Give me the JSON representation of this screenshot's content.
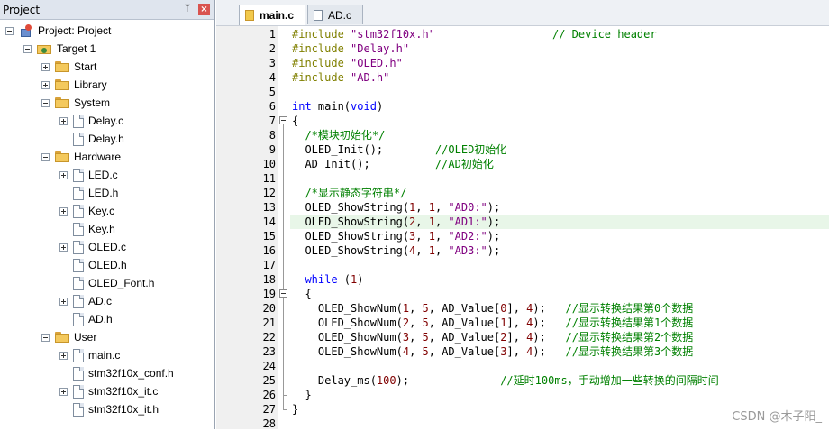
{
  "project_panel": {
    "title": "Project",
    "pin_glyph": "ᛘ",
    "close_glyph": "×",
    "tree": [
      {
        "label": "Project: Project",
        "kind": "project",
        "expander": "minus",
        "level": 0
      },
      {
        "label": "Target 1",
        "kind": "target",
        "expander": "minus",
        "level": 1
      },
      {
        "label": "Start",
        "kind": "folder",
        "expander": "plus",
        "level": 2
      },
      {
        "label": "Library",
        "kind": "folder",
        "expander": "plus",
        "level": 2
      },
      {
        "label": "System",
        "kind": "folder",
        "expander": "minus",
        "level": 2
      },
      {
        "label": "Delay.c",
        "kind": "file",
        "expander": "plus",
        "level": 3
      },
      {
        "label": "Delay.h",
        "kind": "file",
        "expander": "none",
        "level": 3
      },
      {
        "label": "Hardware",
        "kind": "folder",
        "expander": "minus",
        "level": 2
      },
      {
        "label": "LED.c",
        "kind": "file",
        "expander": "plus",
        "level": 3
      },
      {
        "label": "LED.h",
        "kind": "file",
        "expander": "none",
        "level": 3
      },
      {
        "label": "Key.c",
        "kind": "file",
        "expander": "plus",
        "level": 3
      },
      {
        "label": "Key.h",
        "kind": "file",
        "expander": "none",
        "level": 3
      },
      {
        "label": "OLED.c",
        "kind": "file",
        "expander": "plus",
        "level": 3
      },
      {
        "label": "OLED.h",
        "kind": "file",
        "expander": "none",
        "level": 3
      },
      {
        "label": "OLED_Font.h",
        "kind": "file",
        "expander": "none",
        "level": 3
      },
      {
        "label": "AD.c",
        "kind": "file",
        "expander": "plus",
        "level": 3
      },
      {
        "label": "AD.h",
        "kind": "file",
        "expander": "none",
        "level": 3
      },
      {
        "label": "User",
        "kind": "folder",
        "expander": "minus",
        "level": 2
      },
      {
        "label": "main.c",
        "kind": "file",
        "expander": "plus",
        "level": 3
      },
      {
        "label": "stm32f10x_conf.h",
        "kind": "file",
        "expander": "none",
        "level": 3
      },
      {
        "label": "stm32f10x_it.c",
        "kind": "file",
        "expander": "plus",
        "level": 3
      },
      {
        "label": "stm32f10x_it.h",
        "kind": "file",
        "expander": "none",
        "level": 3
      }
    ]
  },
  "tabs": [
    {
      "label": "main.c",
      "active": true
    },
    {
      "label": "AD.c",
      "active": false
    }
  ],
  "editor": {
    "highlighted_line": 14,
    "lines": [
      [
        [
          "pp",
          "#include "
        ],
        [
          "str",
          "\"stm32f10x.h\""
        ],
        [
          "t",
          "                  "
        ],
        [
          "cm",
          "// Device header"
        ]
      ],
      [
        [
          "pp",
          "#include "
        ],
        [
          "str",
          "\"Delay.h\""
        ]
      ],
      [
        [
          "pp",
          "#include "
        ],
        [
          "str",
          "\"OLED.h\""
        ]
      ],
      [
        [
          "pp",
          "#include "
        ],
        [
          "str",
          "\"AD.h\""
        ]
      ],
      [],
      [
        [
          "kw",
          "int"
        ],
        [
          "t",
          " main("
        ],
        [
          "kw",
          "void"
        ],
        [
          "t",
          ")"
        ]
      ],
      [
        [
          "t",
          "{"
        ]
      ],
      [
        [
          "t",
          "  "
        ],
        [
          "cm",
          "/*模块初始化*/"
        ]
      ],
      [
        [
          "t",
          "  OLED_Init();        "
        ],
        [
          "cm",
          "//OLED初始化"
        ]
      ],
      [
        [
          "t",
          "  AD_Init();          "
        ],
        [
          "cm",
          "//AD初始化"
        ]
      ],
      [],
      [
        [
          "t",
          "  "
        ],
        [
          "cm",
          "/*显示静态字符串*/"
        ]
      ],
      [
        [
          "t",
          "  OLED_ShowString("
        ],
        [
          "num",
          "1"
        ],
        [
          "t",
          ", "
        ],
        [
          "num",
          "1"
        ],
        [
          "t",
          ", "
        ],
        [
          "str",
          "\"AD0:\""
        ],
        [
          "t",
          ");"
        ]
      ],
      [
        [
          "t",
          "  OLED_ShowString("
        ],
        [
          "num",
          "2"
        ],
        [
          "t",
          ", "
        ],
        [
          "num",
          "1"
        ],
        [
          "t",
          ", "
        ],
        [
          "str",
          "\"AD1:\""
        ],
        [
          "t",
          ");"
        ]
      ],
      [
        [
          "t",
          "  OLED_ShowString("
        ],
        [
          "num",
          "3"
        ],
        [
          "t",
          ", "
        ],
        [
          "num",
          "1"
        ],
        [
          "t",
          ", "
        ],
        [
          "str",
          "\"AD2:\""
        ],
        [
          "t",
          ");"
        ]
      ],
      [
        [
          "t",
          "  OLED_ShowString("
        ],
        [
          "num",
          "4"
        ],
        [
          "t",
          ", "
        ],
        [
          "num",
          "1"
        ],
        [
          "t",
          ", "
        ],
        [
          "str",
          "\"AD3:\""
        ],
        [
          "t",
          ");"
        ]
      ],
      [],
      [
        [
          "t",
          "  "
        ],
        [
          "kw",
          "while"
        ],
        [
          "t",
          " ("
        ],
        [
          "num",
          "1"
        ],
        [
          "t",
          ")"
        ]
      ],
      [
        [
          "t",
          "  {"
        ]
      ],
      [
        [
          "t",
          "    OLED_ShowNum("
        ],
        [
          "num",
          "1"
        ],
        [
          "t",
          ", "
        ],
        [
          "num",
          "5"
        ],
        [
          "t",
          ", AD_Value["
        ],
        [
          "num",
          "0"
        ],
        [
          "t",
          "], "
        ],
        [
          "num",
          "4"
        ],
        [
          "t",
          ");   "
        ],
        [
          "cm",
          "//显示转换结果第0个数据"
        ]
      ],
      [
        [
          "t",
          "    OLED_ShowNum("
        ],
        [
          "num",
          "2"
        ],
        [
          "t",
          ", "
        ],
        [
          "num",
          "5"
        ],
        [
          "t",
          ", AD_Value["
        ],
        [
          "num",
          "1"
        ],
        [
          "t",
          "], "
        ],
        [
          "num",
          "4"
        ],
        [
          "t",
          ");   "
        ],
        [
          "cm",
          "//显示转换结果第1个数据"
        ]
      ],
      [
        [
          "t",
          "    OLED_ShowNum("
        ],
        [
          "num",
          "3"
        ],
        [
          "t",
          ", "
        ],
        [
          "num",
          "5"
        ],
        [
          "t",
          ", AD_Value["
        ],
        [
          "num",
          "2"
        ],
        [
          "t",
          "], "
        ],
        [
          "num",
          "4"
        ],
        [
          "t",
          ");   "
        ],
        [
          "cm",
          "//显示转换结果第2个数据"
        ]
      ],
      [
        [
          "t",
          "    OLED_ShowNum("
        ],
        [
          "num",
          "4"
        ],
        [
          "t",
          ", "
        ],
        [
          "num",
          "5"
        ],
        [
          "t",
          ", AD_Value["
        ],
        [
          "num",
          "3"
        ],
        [
          "t",
          "], "
        ],
        [
          "num",
          "4"
        ],
        [
          "t",
          ");   "
        ],
        [
          "cm",
          "//显示转换结果第3个数据"
        ]
      ],
      [],
      [
        [
          "t",
          "    Delay_ms("
        ],
        [
          "num",
          "100"
        ],
        [
          "t",
          ");              "
        ],
        [
          "cm",
          "//延时100ms，手动增加一些转换的间隔时间"
        ]
      ],
      [
        [
          "t",
          "  }"
        ]
      ],
      [
        [
          "t",
          "}"
        ]
      ],
      []
    ]
  },
  "watermark": "CSDN @木子阳_"
}
